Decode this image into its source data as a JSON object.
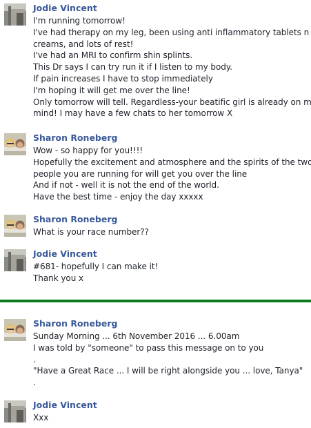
{
  "posts": [
    {
      "author": "Jodie Vincent",
      "avatar": "jodie-avatar",
      "lines": [
        "I'm running tomorrow!",
        "I've had therapy on my leg, been using anti inflammatory tablets n",
        "creams, and lots of rest!",
        "I've had an MRI to confirm shin splints.",
        "This Dr says I can try run it if I listen to my body.",
        "If pain increases I have to stop immediately",
        "I'm hoping it will get me over the line!",
        "Only tomorrow will tell. Regardless-your beatific girl is already on my",
        "mind! I may have a few chats to her tomorrow X"
      ]
    },
    {
      "author": "Sharon Roneberg",
      "avatar": "sharon-avatar",
      "lines": [
        "Wow - so happy for you!!!!",
        "Hopefully the excitement and atmosphere and the spirits of the two",
        "people you are running for will get you over the line",
        "And if not - well it is not the end of the world.",
        "Have the best time - enjoy the day xxxxx"
      ]
    },
    {
      "author": "Sharon Roneberg",
      "avatar": "sharon-avatar",
      "lines": [
        "What is your race number??"
      ]
    },
    {
      "author": "Jodie Vincent",
      "avatar": "jodie-avatar",
      "lines": [
        "#681- hopefully I can make it!",
        "Thank you x"
      ]
    },
    {
      "author": "Sharon Roneberg",
      "avatar": "sharon-avatar",
      "lines": [
        "Sunday Morning ... 6th November 2016 ... 6.00am",
        "I was told by \"someone\" to pass this message on to you",
        ".",
        "\"Have a Great Race ... I will be right alongside you ... love, Tanya\"",
        "."
      ]
    },
    {
      "author": "Jodie Vincent",
      "avatar": "jodie-avatar",
      "lines": [
        "Xxx"
      ]
    }
  ],
  "colors": {
    "author": "#3b5998",
    "text": "#1d2129",
    "divider": "#0b7a1e"
  }
}
